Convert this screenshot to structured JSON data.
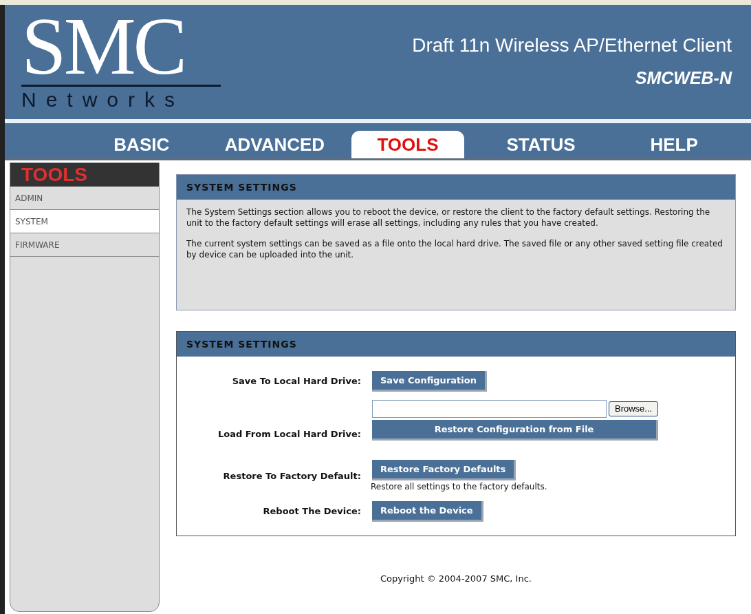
{
  "header": {
    "logo_title": "SMC",
    "logo_subtitle": "Networks",
    "product": "Draft 11n Wireless AP/Ethernet Client",
    "model": "SMCWEB-N"
  },
  "nav_tabs": [
    {
      "label": "BASIC",
      "selected": false
    },
    {
      "label": "ADVANCED",
      "selected": false
    },
    {
      "label": "TOOLS",
      "selected": true
    },
    {
      "label": "STATUS",
      "selected": false
    },
    {
      "label": "HELP",
      "selected": false
    }
  ],
  "sidebar": {
    "heading": "TOOLS",
    "items": [
      {
        "label": "ADMIN",
        "selected": false
      },
      {
        "label": "SYSTEM",
        "selected": true
      },
      {
        "label": "FIRMWARE",
        "selected": false
      }
    ]
  },
  "intro_panel": {
    "title": "SYSTEM SETTINGS",
    "paragraphs": [
      "The System Settings section allows you to reboot the device, or restore the client to the factory default settings. Restoring the unit to the factory default settings will erase all settings, including any rules that you have created.",
      "The current system settings can be saved as a file onto the local hard drive. The saved file or any other saved setting file created by device can be uploaded into the unit."
    ]
  },
  "settings_panel": {
    "title": "SYSTEM SETTINGS",
    "rows": [
      {
        "kind": "button",
        "label": "Save To Local Hard Drive:",
        "button": "Save Configuration"
      },
      {
        "kind": "file",
        "label": "Load From Local Hard Drive:",
        "browse": "Browse...",
        "button": "Restore Configuration from File"
      },
      {
        "kind": "note",
        "label": "Restore To Factory Default:",
        "button": "Restore Factory Defaults",
        "note": "Restore all settings to the factory defaults."
      },
      {
        "kind": "button",
        "label": "Reboot The Device:",
        "button": "Reboot the Device"
      }
    ]
  },
  "footer": {
    "copyright": "Copyright © 2004-2007 SMC, Inc."
  }
}
